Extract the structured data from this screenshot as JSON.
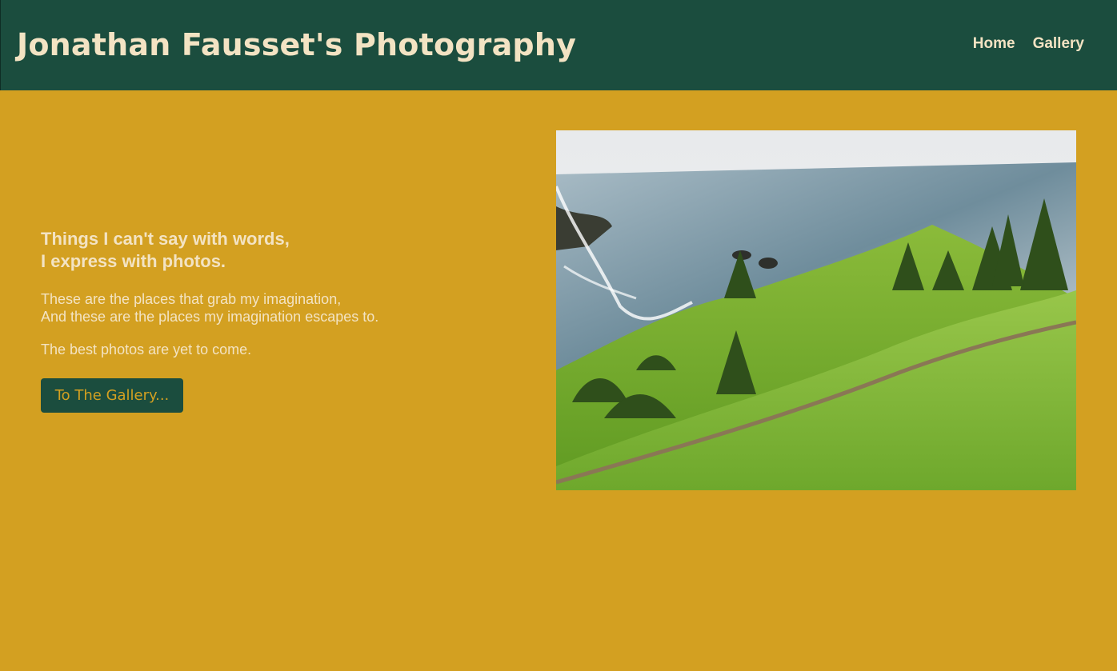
{
  "header": {
    "title": "Jonathan Fausset's Photography",
    "nav": [
      {
        "label": "Home"
      },
      {
        "label": "Gallery"
      }
    ]
  },
  "intro": {
    "tagline_line1": "Things I can't say with words,",
    "tagline_line2": "I express with photos.",
    "para1_line1": "These are the places that grab my imagination,",
    "para1_line2": "And these are the places my imagination escapes to.",
    "para2": "The best photos are yet to come.",
    "cta_label": "To The Gallery..."
  },
  "colors": {
    "header_bg": "#1b4d3e",
    "page_bg": "#d3a021",
    "text_light": "#f3e3c3"
  },
  "hero_image": {
    "description_icon": "coastal-hillside-photo"
  }
}
